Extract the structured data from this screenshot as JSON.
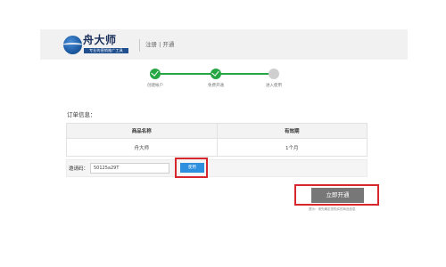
{
  "header": {
    "logo_text": "舟大师",
    "logo_tagline": "专业的营销推广工具",
    "title": "注册 | 开通"
  },
  "steps": [
    {
      "label": "创建帐户",
      "status": "done"
    },
    {
      "label": "免费开通",
      "status": "done"
    },
    {
      "label": "进入使用",
      "status": "pending"
    }
  ],
  "order": {
    "section_title": "订单信息：",
    "columns": [
      "商品名称",
      "有效期"
    ],
    "rows": [
      {
        "product": "舟大师",
        "validity": "1个月"
      }
    ]
  },
  "invite": {
    "label": "邀请码：",
    "value": "50125a29T",
    "use_button": "使用"
  },
  "actions": {
    "open_button": "立即开通",
    "note": "提示：请先确定您购买的商品信息"
  },
  "colors": {
    "step_done": "#27a644",
    "step_pending": "#cfcfcf",
    "use_button": "#2f8fdf",
    "open_button": "#777777",
    "highlight": "#d8262f"
  }
}
